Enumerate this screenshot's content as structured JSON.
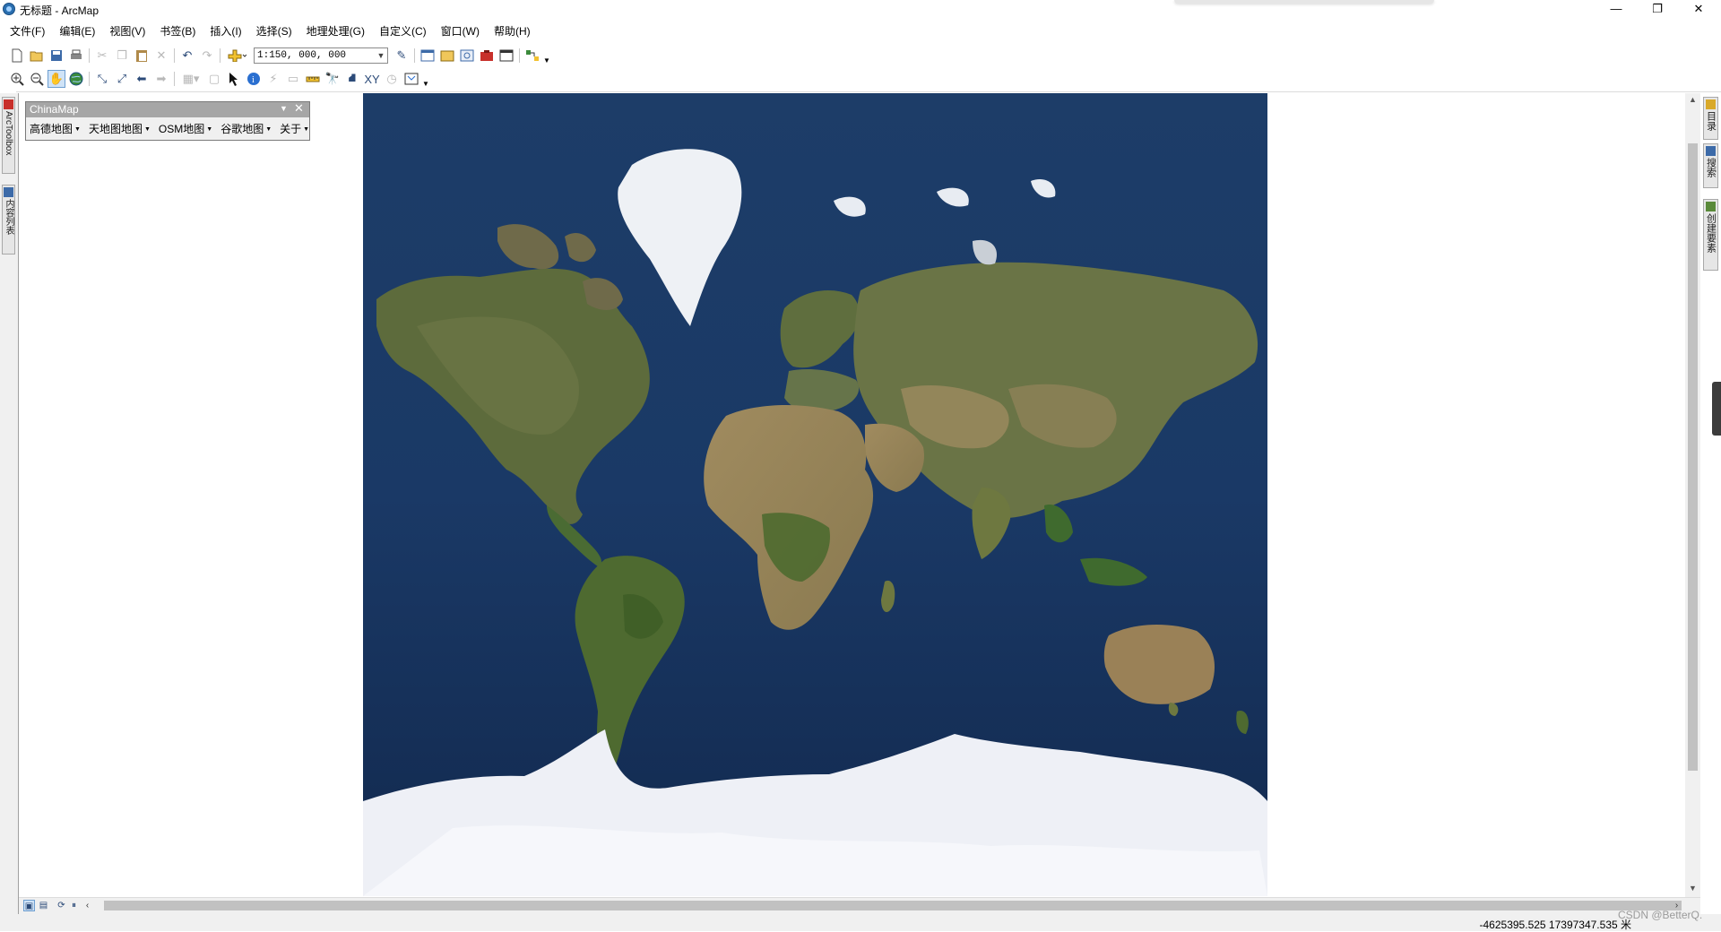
{
  "window": {
    "title": "无标题 - ArcMap",
    "minimize_glyph": "—",
    "restore_glyph": "❐",
    "close_glyph": "✕"
  },
  "menubar": {
    "items": [
      "文件(F)",
      "编辑(E)",
      "视图(V)",
      "书签(B)",
      "插入(I)",
      "选择(S)",
      "地理处理(G)",
      "自定义(C)",
      "窗口(W)",
      "帮助(H)"
    ]
  },
  "standard_toolbar": {
    "scale_value": "1:150, 000, 000"
  },
  "left_dock": {
    "tabs": [
      {
        "label": "ArcToolbox",
        "icon": "arctoolbox-icon"
      },
      {
        "label": "内容列表",
        "icon": "table-of-contents-icon"
      }
    ]
  },
  "right_dock": {
    "tabs": [
      {
        "label": "目录",
        "icon": "catalog-icon"
      },
      {
        "label": "搜索",
        "icon": "search-icon"
      },
      {
        "label": "创建要素",
        "icon": "create-features-icon"
      }
    ]
  },
  "chinamap_toolbar": {
    "title": "ChinaMap",
    "items": [
      "高德地图",
      "天地图地图",
      "OSM地图",
      "谷歌地图",
      "关于"
    ]
  },
  "map": {
    "description_colors": {
      "ocean": "#17365f",
      "land": "#5a6a3a",
      "ice": "#eef1f6"
    }
  },
  "statusbar": {
    "coordinates": "-4625395.525  17397347.535 米"
  },
  "watermark": "CSDN @BetterQ."
}
